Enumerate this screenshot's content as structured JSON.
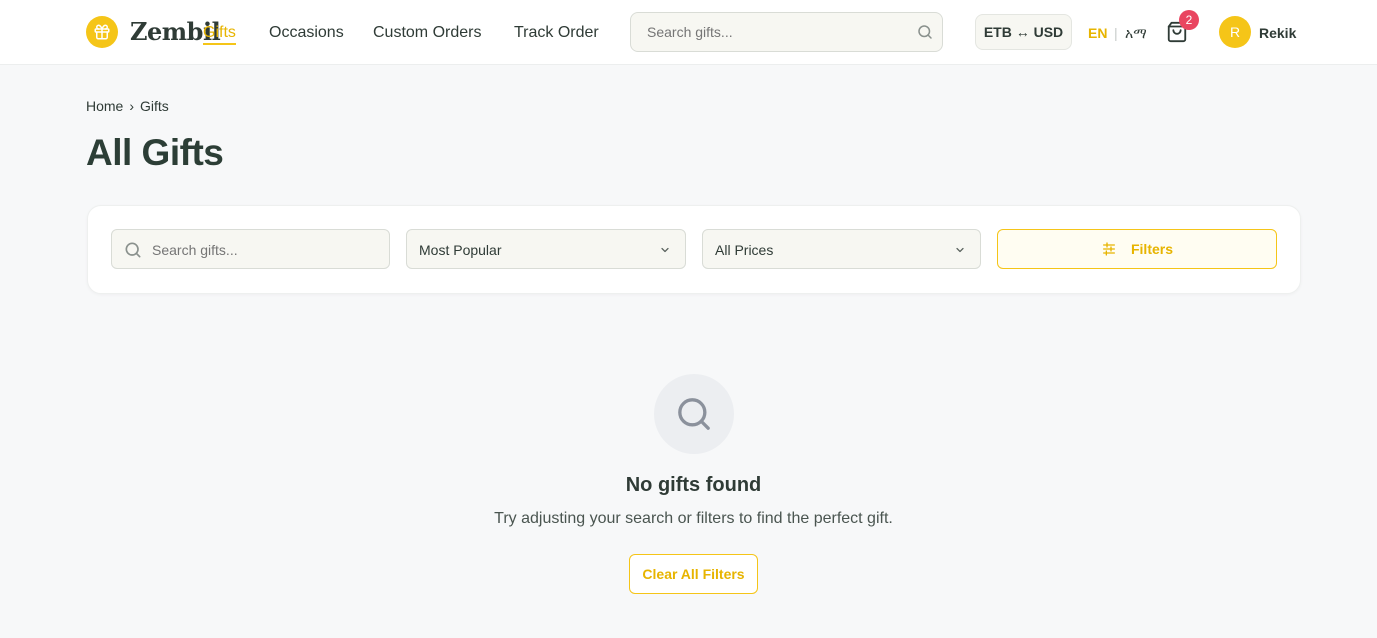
{
  "header": {
    "logo": {
      "icon": "gift-icon",
      "name": "Zembil",
      "accent": "Gifts"
    },
    "nav": [
      {
        "label": "Occasions"
      },
      {
        "label": "Custom Orders"
      },
      {
        "label": "Track Order"
      }
    ],
    "search": {
      "placeholder": "Search gifts...",
      "icon": "search-icon"
    },
    "currency_toggle": "ETB ↔ USD",
    "lang": {
      "en": "EN",
      "separator": "|",
      "am": "አማ"
    },
    "cart": {
      "icon": "shopping-bag-icon",
      "count": "2"
    },
    "user": {
      "initial": "R",
      "name": "Rekik"
    }
  },
  "breadcrumb": [
    {
      "label": "Home"
    },
    {
      "label": "›"
    },
    {
      "label": "Gifts"
    }
  ],
  "page_title": "All Gifts",
  "filters": {
    "search_placeholder": "Search gifts...",
    "sort_value": "Most Popular",
    "price_value": "All Prices",
    "filters_button": "Filters",
    "filters_icon": "sliders-icon"
  },
  "empty_state": {
    "icon": "search-icon",
    "title": "No gifts found",
    "message": "Try adjusting your search or filters to find the perfect gift.",
    "button": "Clear All Filters"
  },
  "colors": {
    "brand_yellow": "#f5c518",
    "accent_text": "#e7b400",
    "badge_red": "#e94560",
    "text_dark": "#2f3b36"
  }
}
